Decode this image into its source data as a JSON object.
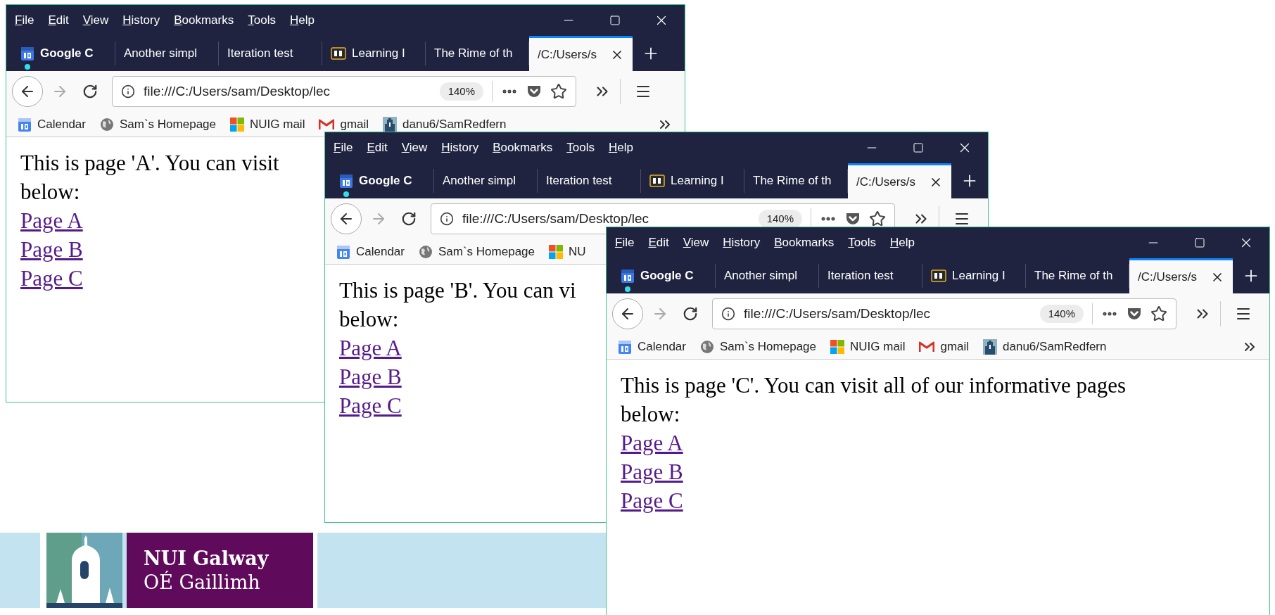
{
  "windows": [
    {
      "menu": [
        "File",
        "Edit",
        "View",
        "History",
        "Bookmarks",
        "Tools",
        "Help"
      ],
      "tabs": [
        {
          "label": "Google C",
          "kind": "calendar",
          "attention": true,
          "selected": false
        },
        {
          "label": "Another simpl",
          "kind": "plain",
          "attention": false,
          "selected": false
        },
        {
          "label": "Iteration test",
          "kind": "plain",
          "attention": false,
          "selected": false
        },
        {
          "label": "Learning I",
          "kind": "blackboard",
          "attention": false,
          "selected": false
        },
        {
          "label": "The Rime of th",
          "kind": "plain",
          "attention": false,
          "selected": false
        },
        {
          "label": "/C:/Users/s",
          "kind": "plain",
          "attention": false,
          "selected": true
        }
      ],
      "url": "file:///C:/Users/sam/Desktop/lec",
      "zoom": "140%",
      "bookmarks": [
        {
          "label": "Calendar",
          "kind": "calendar"
        },
        {
          "label": "Sam`s Homepage",
          "kind": "globe"
        },
        {
          "label": "NUIG mail",
          "kind": "windows"
        },
        {
          "label": "gmail",
          "kind": "gmail"
        },
        {
          "label": "danu6/SamRedfern",
          "kind": "building"
        }
      ],
      "bookmarks_overflow": true,
      "content": {
        "text": "This is page 'A'. You can visit",
        "text_2": "below:",
        "links": [
          "Page A",
          "Page B",
          "Page C"
        ]
      }
    },
    {
      "menu": [
        "File",
        "Edit",
        "View",
        "History",
        "Bookmarks",
        "Tools",
        "Help"
      ],
      "tabs": [
        {
          "label": "Google C",
          "kind": "calendar",
          "attention": true,
          "selected": false
        },
        {
          "label": "Another simpl",
          "kind": "plain",
          "attention": false,
          "selected": false
        },
        {
          "label": "Iteration test",
          "kind": "plain",
          "attention": false,
          "selected": false
        },
        {
          "label": "Learning I",
          "kind": "blackboard",
          "attention": false,
          "selected": false
        },
        {
          "label": "The Rime of th",
          "kind": "plain",
          "attention": false,
          "selected": false
        },
        {
          "label": "/C:/Users/s",
          "kind": "plain",
          "attention": false,
          "selected": true
        }
      ],
      "url": "file:///C:/Users/sam/Desktop/lec",
      "zoom": "140%",
      "bookmarks": [
        {
          "label": "Calendar",
          "kind": "calendar"
        },
        {
          "label": "Sam`s Homepage",
          "kind": "globe"
        },
        {
          "label": "NU",
          "kind": "windows"
        }
      ],
      "bookmarks_overflow": false,
      "content": {
        "text": "This is page 'B'. You can vi",
        "text_2": "below:",
        "links": [
          "Page A",
          "Page B",
          "Page C"
        ]
      }
    },
    {
      "menu": [
        "File",
        "Edit",
        "View",
        "History",
        "Bookmarks",
        "Tools",
        "Help"
      ],
      "tabs": [
        {
          "label": "Google C",
          "kind": "calendar",
          "attention": true,
          "selected": false
        },
        {
          "label": "Another simpl",
          "kind": "plain",
          "attention": false,
          "selected": false
        },
        {
          "label": "Iteration test",
          "kind": "plain",
          "attention": false,
          "selected": false
        },
        {
          "label": "Learning I",
          "kind": "blackboard",
          "attention": false,
          "selected": false
        },
        {
          "label": "The Rime of th",
          "kind": "plain",
          "attention": false,
          "selected": false
        },
        {
          "label": "/C:/Users/s",
          "kind": "plain",
          "attention": false,
          "selected": true
        }
      ],
      "url": "file:///C:/Users/sam/Desktop/lec",
      "zoom": "140%",
      "bookmarks": [
        {
          "label": "Calendar",
          "kind": "calendar"
        },
        {
          "label": "Sam`s Homepage",
          "kind": "globe"
        },
        {
          "label": "NUIG mail",
          "kind": "windows"
        },
        {
          "label": "gmail",
          "kind": "gmail"
        },
        {
          "label": "danu6/SamRedfern",
          "kind": "building"
        }
      ],
      "bookmarks_overflow": true,
      "content": {
        "text": "This is page 'C'. You can visit all of our informative pages",
        "text_2": "below:",
        "links": [
          "Page A",
          "Page B",
          "Page C"
        ]
      }
    }
  ],
  "banner": {
    "title": "NUI Galway",
    "subtitle": "OÉ Gaillimh"
  }
}
